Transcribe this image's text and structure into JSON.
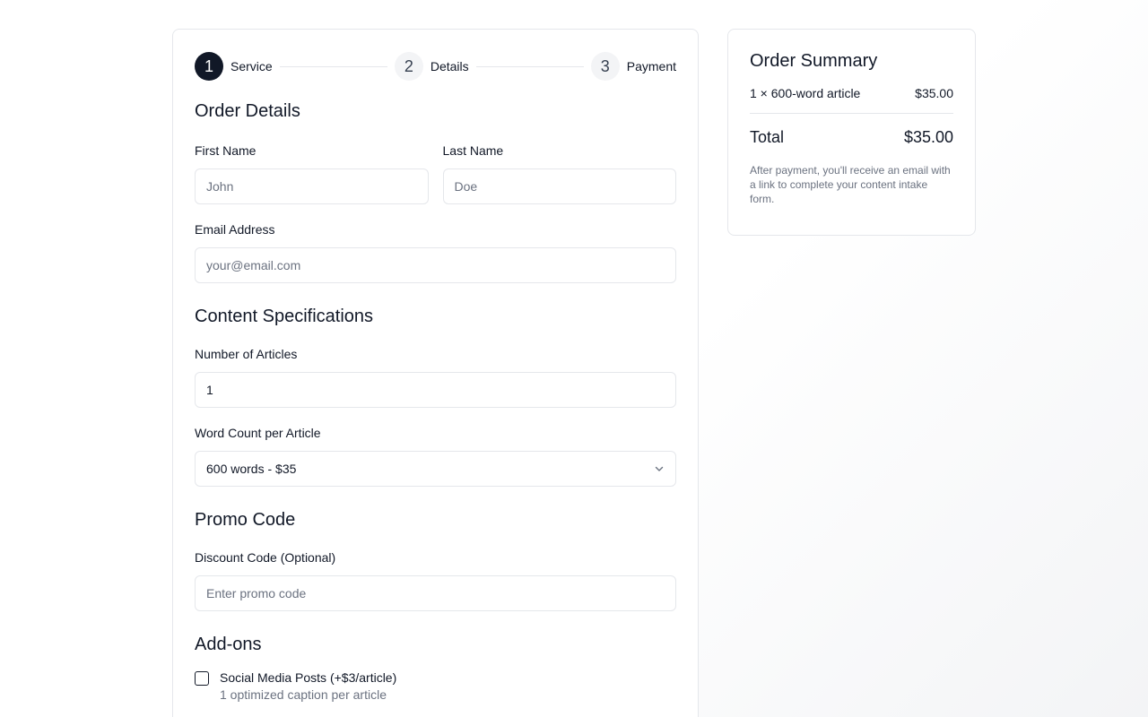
{
  "steps": [
    {
      "number": "1",
      "label": "Service"
    },
    {
      "number": "2",
      "label": "Details"
    },
    {
      "number": "3",
      "label": "Payment"
    }
  ],
  "form": {
    "title": "Order Details",
    "first_name": {
      "label": "First Name",
      "placeholder": "John",
      "value": ""
    },
    "last_name": {
      "label": "Last Name",
      "placeholder": "Doe",
      "value": ""
    },
    "email": {
      "label": "Email Address",
      "placeholder": "your@email.com",
      "value": ""
    },
    "content_specs": {
      "title": "Content Specifications",
      "articles": {
        "label": "Number of Articles",
        "value": "1"
      },
      "word_count": {
        "label": "Word Count per Article",
        "selected": "600 words - $35"
      }
    },
    "promo": {
      "title": "Promo Code",
      "discount": {
        "label": "Discount Code (Optional)",
        "placeholder": "Enter promo code",
        "value": ""
      }
    },
    "addons": {
      "title": "Add-ons",
      "items": [
        {
          "label": "Social Media Posts (+$3/article)",
          "description": "1 optimized caption per article",
          "checked": false
        }
      ]
    }
  },
  "summary": {
    "title": "Order Summary",
    "line_item": {
      "label": "1 × 600-word article",
      "price": "$35.00"
    },
    "total_label": "Total",
    "total_value": "$35.00",
    "note": "After payment, you'll receive an email with a link to complete your content intake form."
  },
  "colors": {
    "accent": "#111827",
    "border": "#e5e7eb",
    "muted": "#6b7280"
  }
}
